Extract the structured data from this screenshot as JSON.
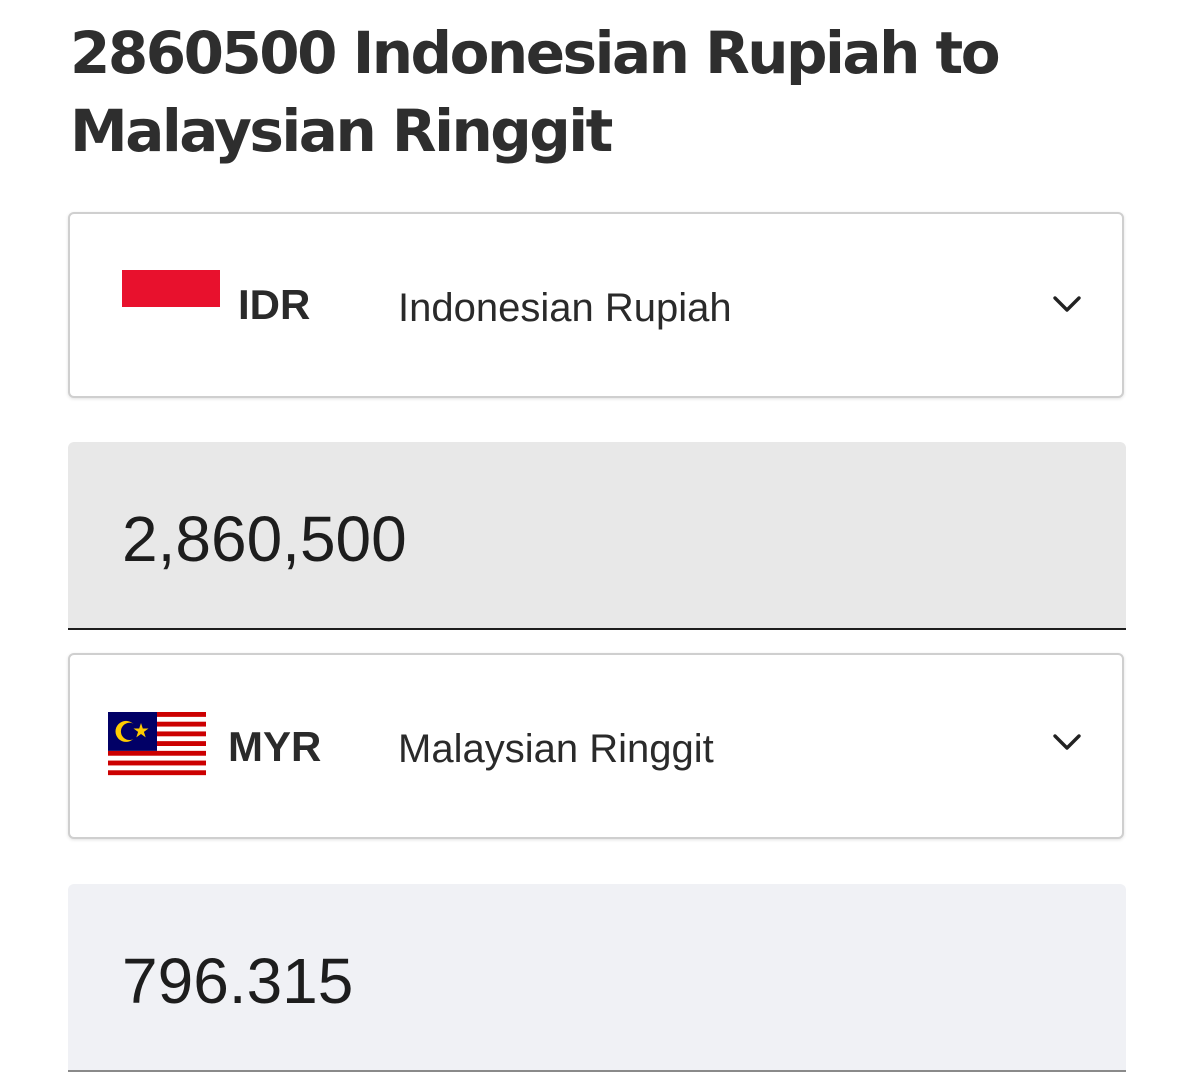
{
  "page_title": "2860500 Indonesian Rupiah to Malaysian Ringgit",
  "from_currency": {
    "code": "IDR",
    "name": "Indonesian Rupiah",
    "flag_icon": "indonesia-flag-icon"
  },
  "amount_input": {
    "value": "2,860,500"
  },
  "to_currency": {
    "code": "MYR",
    "name": "Malaysian Ringgit",
    "flag_icon": "malaysia-flag-icon"
  },
  "converted_amount": {
    "value": "796.315"
  },
  "colors": {
    "input_background": "#e8e8e8",
    "output_background": "#f0f1f5",
    "indonesia_red": "#e8112d",
    "malaysia_blue": "#010066",
    "malaysia_red": "#cc0001",
    "malaysia_yellow": "#ffcc00"
  }
}
